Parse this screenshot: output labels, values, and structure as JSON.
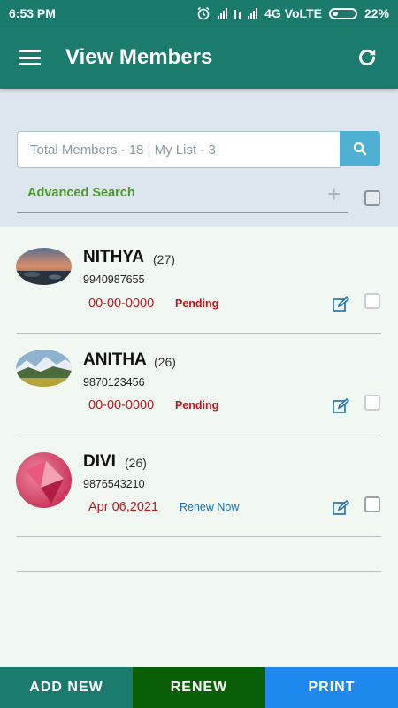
{
  "status": {
    "time": "6:53 PM",
    "network": "4G VoLTE",
    "battery": "22%"
  },
  "header": {
    "title": "View Members"
  },
  "search": {
    "placeholder": "Total Members - 18 | My List - 3",
    "advanced_label": "Advanced Search"
  },
  "members": [
    {
      "name": "NITHYA",
      "age": "(27)",
      "phone": "9940987655",
      "date": "00-00-0000",
      "status": "Pending",
      "status_color": "#c2161c"
    },
    {
      "name": "ANITHA",
      "age": "(26)",
      "phone": "9870123456",
      "date": "00-00-0000",
      "status": "Pending",
      "status_color": "#c2161c"
    },
    {
      "name": "DIVI",
      "age": "(26)",
      "phone": "9876543210",
      "date": "Apr 06,2021",
      "status": "Renew Now",
      "status_color": "#1e6fb0"
    }
  ],
  "footer": {
    "add_new": "ADD NEW",
    "renew": "RENEW",
    "print": "PRINT"
  },
  "colors": {
    "primary": "#1b7b6d",
    "renew": "#0a5e06",
    "print": "#1e88ee",
    "accent_green": "#4a9a2a",
    "date_red": "#c2161c"
  }
}
